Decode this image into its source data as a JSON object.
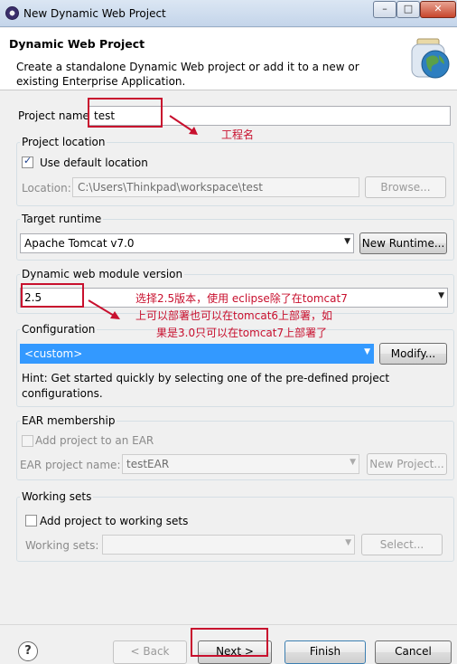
{
  "window": {
    "title": "New Dynamic Web Project",
    "minimize": "–",
    "maximize": "□",
    "close": "✕"
  },
  "header": {
    "title": "Dynamic Web Project",
    "description": "Create a standalone Dynamic Web project or add it to a new or existing Enterprise Application."
  },
  "project_name": {
    "label": "Project name",
    "value": "test"
  },
  "project_location": {
    "group_title": "Project location",
    "use_default_label": "Use default location",
    "use_default_checked": true,
    "location_label": "Location:",
    "location_value": "C:\\Users\\Thinkpad\\workspace\\test",
    "browse_label": "Browse..."
  },
  "target_runtime": {
    "group_title": "Target runtime",
    "selected": "Apache Tomcat v7.0",
    "new_runtime_label": "New Runtime..."
  },
  "module_version": {
    "group_title": "Dynamic web module version",
    "selected": "2.5"
  },
  "configuration": {
    "group_title": "Configuration",
    "selected": "<custom>",
    "modify_label": "Modify...",
    "hint": "Hint: Get started quickly by selecting one of the pre-defined project configurations."
  },
  "ear": {
    "group_title": "EAR membership",
    "add_label": "Add project to an EAR",
    "add_checked": false,
    "project_name_label": "EAR project name:",
    "project_name_value": "testEAR",
    "new_project_label": "New Project..."
  },
  "working_sets": {
    "group_title": "Working sets",
    "add_label": "Add project to working sets",
    "add_checked": false,
    "sets_label": "Working sets:",
    "sets_value": "",
    "select_label": "Select..."
  },
  "footer": {
    "help": "?",
    "back_label": "< Back",
    "next_label": "Next >",
    "finish_label": "Finish",
    "cancel_label": "Cancel"
  },
  "annotations": {
    "project_name_note": "工程名",
    "version_note_line1": "选择2.5版本，使用 eclipse除了在tomcat7",
    "version_note_line2": "上可以部署也可以在tomcat6上部署，如",
    "version_note_line3": "果是3.0只可以在tomcat7上部署了",
    "color": "#c8102e"
  }
}
